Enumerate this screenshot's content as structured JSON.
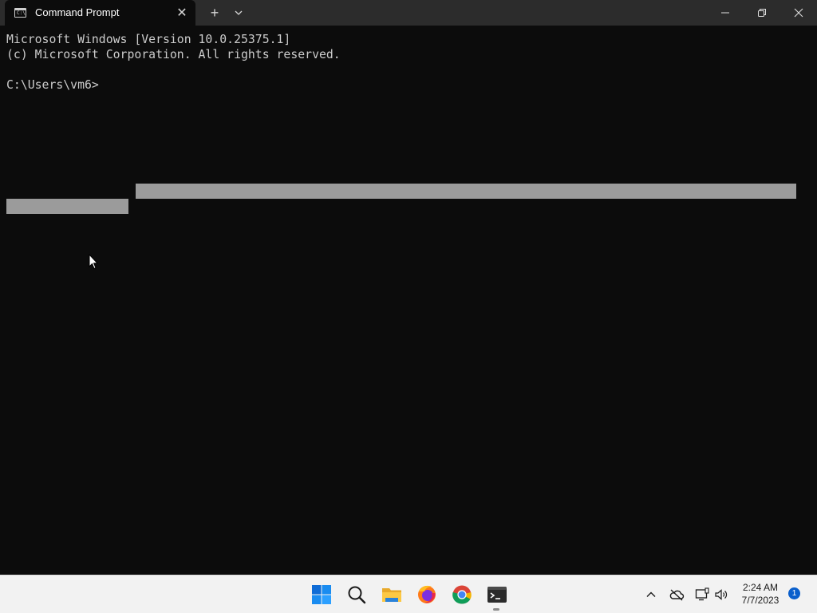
{
  "window": {
    "tab_title": "Command Prompt",
    "tab_icon_text": "C:\\",
    "new_tab_label": "+",
    "close_tab_label": "✕"
  },
  "terminal": {
    "lines": [
      "Microsoft Windows [Version 10.0.25375.1]",
      "(c) Microsoft Corporation. All rights reserved.",
      "",
      "C:\\Users\\vm6>"
    ]
  },
  "taskbar": {
    "icons": [
      "windows-start-icon",
      "search-icon",
      "file-explorer-icon",
      "firefox-icon",
      "chrome-icon",
      "terminal-icon"
    ],
    "tray_icons": [
      "chevron-up-icon",
      "onedrive-offline-icon",
      "network-icon",
      "volume-icon"
    ],
    "time": "2:24 AM",
    "date": "7/7/2023",
    "notification_count": "1"
  },
  "colors": {
    "terminal_bg": "#0c0c0c",
    "terminal_text": "#cccccc",
    "titlebar_bg": "#2c2c2c",
    "selection": "#9b9b9b",
    "taskbar_bg": "#f2f2f2",
    "badge": "#0a5fcc"
  }
}
